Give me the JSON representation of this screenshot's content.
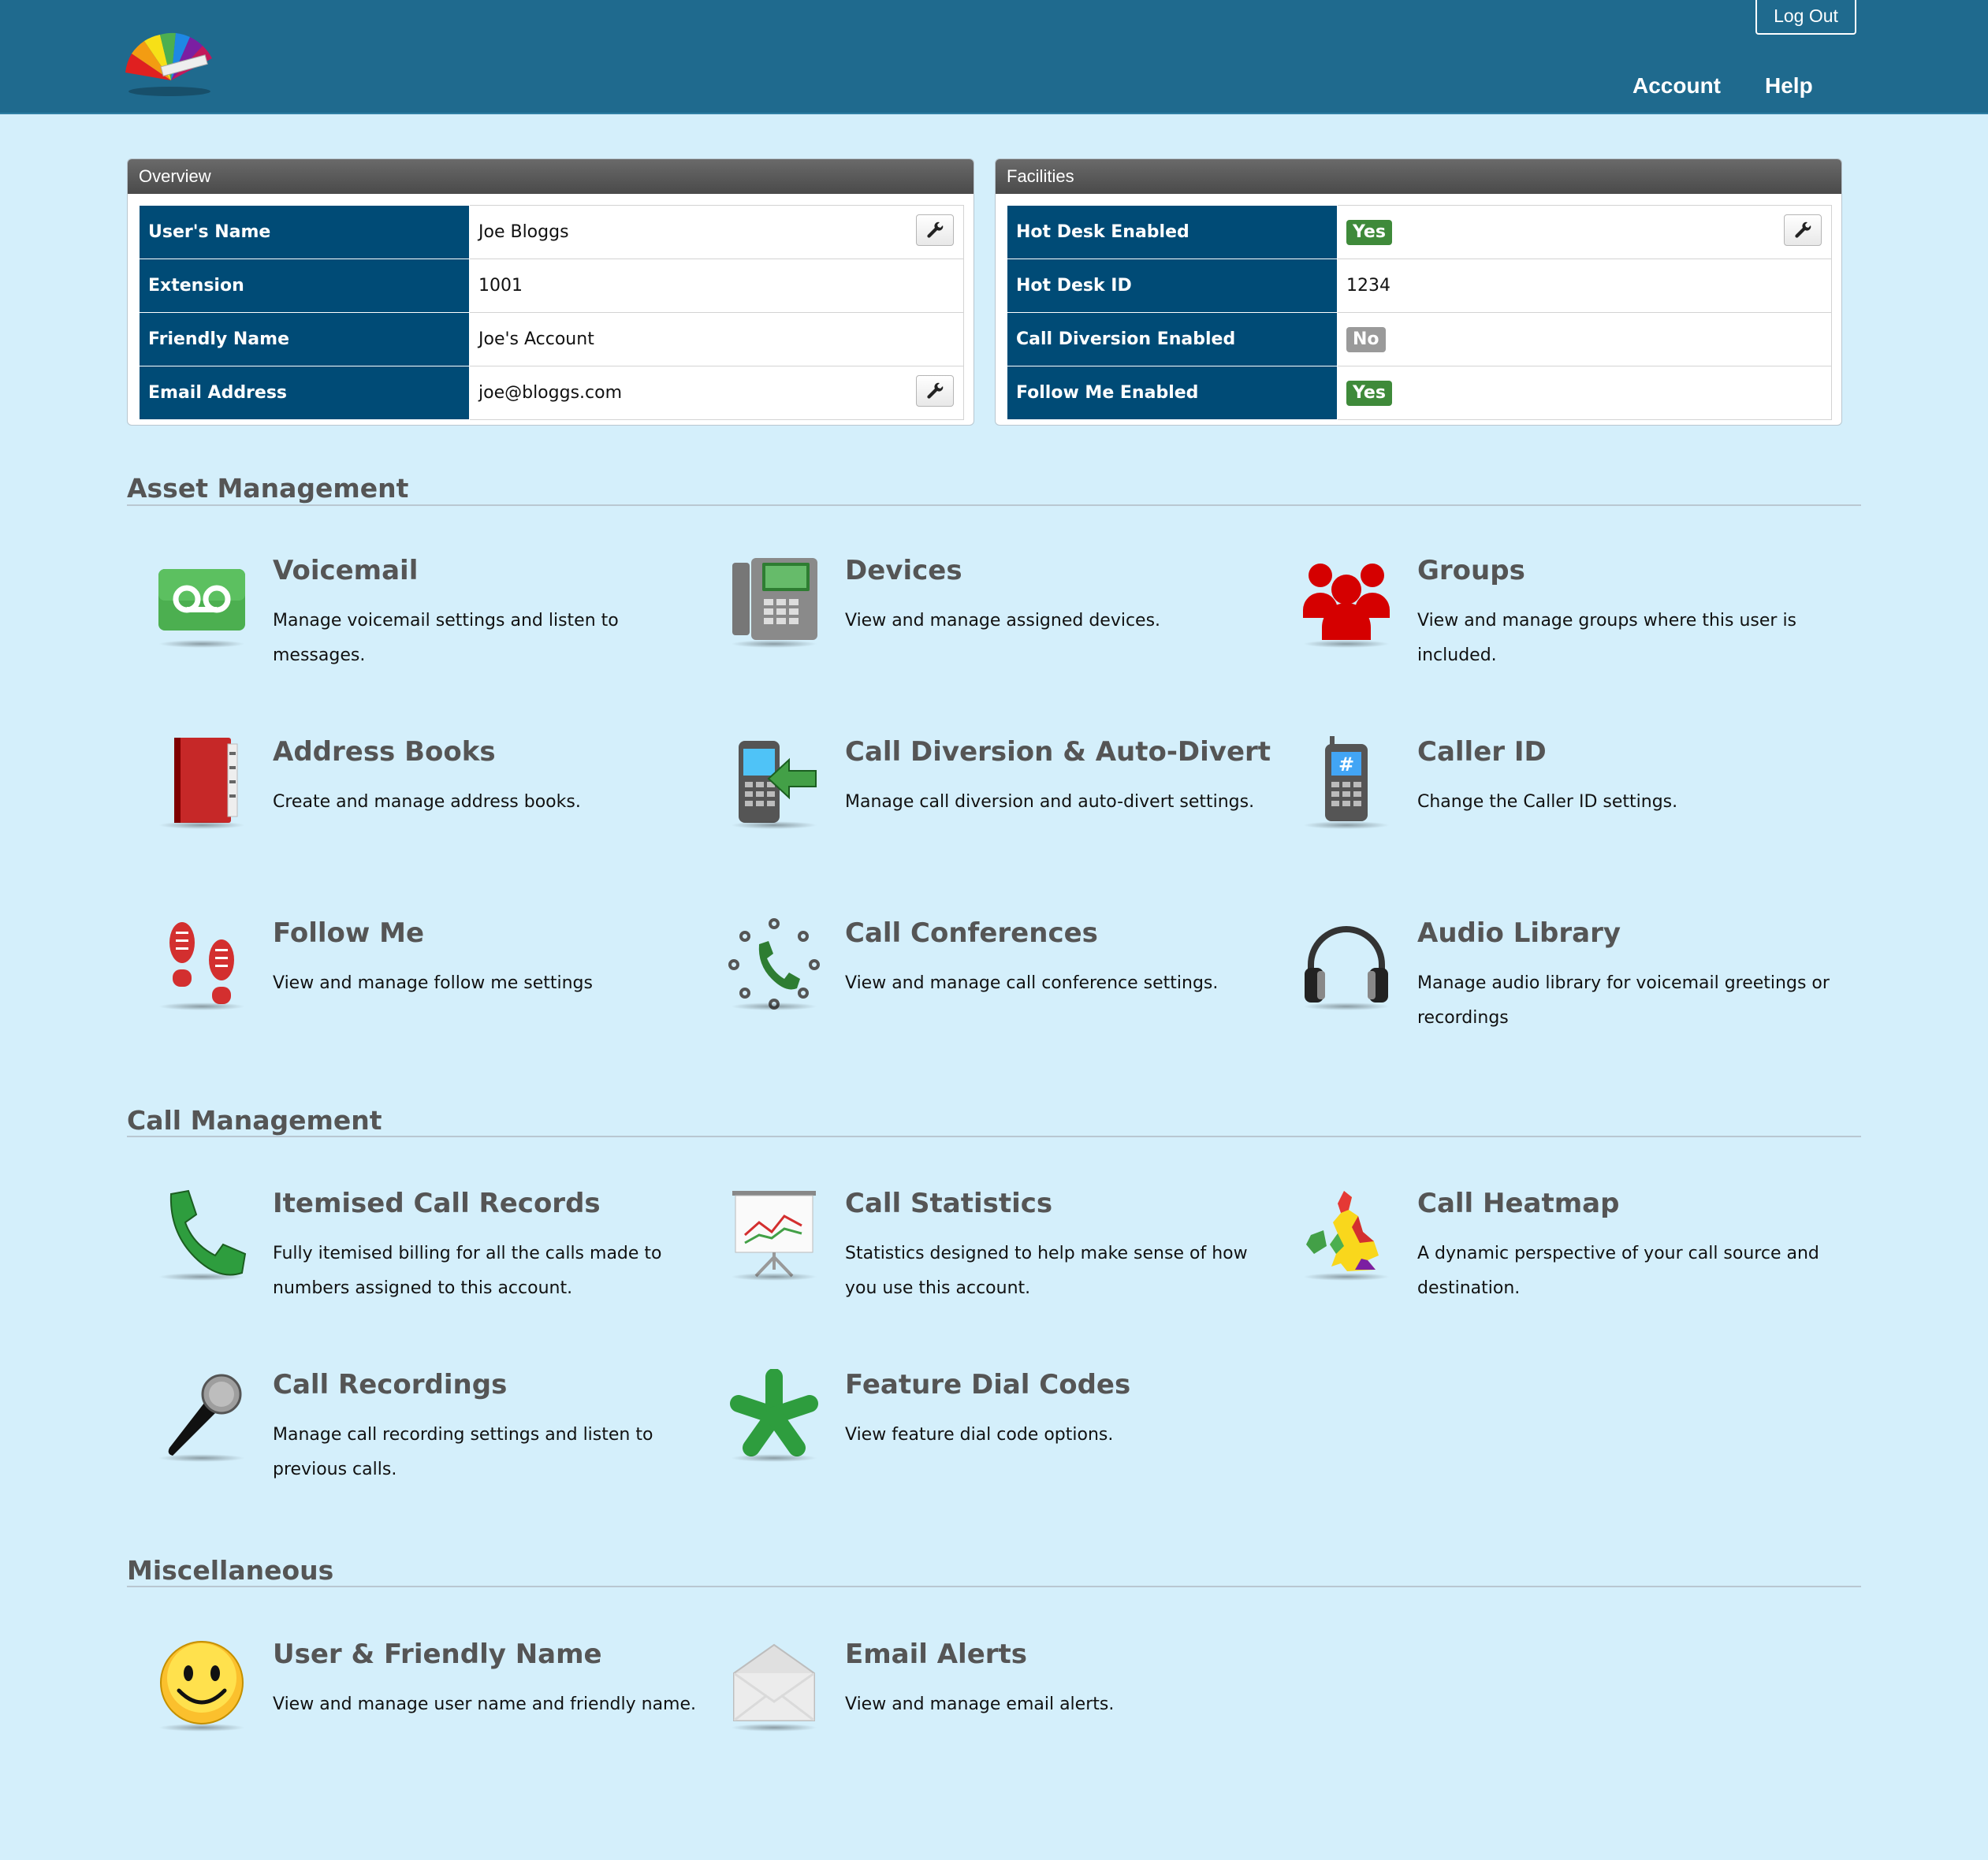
{
  "header": {
    "logout_label": "Log Out",
    "nav": {
      "account": "Account",
      "help": "Help"
    }
  },
  "overview": {
    "title": "Overview",
    "rows": [
      {
        "label": "User's Name",
        "value": "Joe Bloggs"
      },
      {
        "label": "Extension",
        "value": "1001"
      },
      {
        "label": "Friendly Name",
        "value": "Joe's Account"
      },
      {
        "label": "Email Address",
        "value": "joe@bloggs.com"
      }
    ]
  },
  "facilities": {
    "title": "Facilities",
    "rows": [
      {
        "label": "Hot Desk Enabled",
        "value": "Yes"
      },
      {
        "label": "Hot Desk ID",
        "value": "1234"
      },
      {
        "label": "Call Diversion Enabled",
        "value": "No"
      },
      {
        "label": "Follow Me Enabled",
        "value": "Yes"
      }
    ]
  },
  "sections": {
    "asset": {
      "title": "Asset Management",
      "items": [
        {
          "title": "Voicemail",
          "desc": "Manage voicemail settings and listen to messages.",
          "icon": "voicemail-icon"
        },
        {
          "title": "Devices",
          "desc": "View and manage assigned devices.",
          "icon": "desk-phone-icon"
        },
        {
          "title": "Groups",
          "desc": "View and manage groups where this user is included.",
          "icon": "group-icon"
        },
        {
          "title": "Address Books",
          "desc": "Create and manage address books.",
          "icon": "address-book-icon"
        },
        {
          "title": "Call Diversion & Auto-Divert",
          "desc": "Manage call diversion and auto-divert settings.",
          "icon": "call-diversion-icon"
        },
        {
          "title": "Caller ID",
          "desc": "Change the Caller ID settings.",
          "icon": "mobile-phone-icon"
        },
        {
          "title": "Follow Me",
          "desc": "View and manage follow me settings",
          "icon": "footprints-icon"
        },
        {
          "title": "Call Conferences",
          "desc": "View and manage call conference settings.",
          "icon": "conference-icon"
        },
        {
          "title": "Audio Library",
          "desc": "Manage audio library for voicemail greetings or recordings",
          "icon": "headphones-icon"
        }
      ]
    },
    "call": {
      "title": "Call Management",
      "items": [
        {
          "title": "Itemised Call Records",
          "desc": "Fully itemised billing for all the calls made to numbers assigned to this account.",
          "icon": "phone-handset-icon"
        },
        {
          "title": "Call Statistics",
          "desc": "Statistics designed to help make sense of how you use this account.",
          "icon": "statistics-board-icon"
        },
        {
          "title": "Call Heatmap",
          "desc": "A dynamic perspective of your call source and destination.",
          "icon": "heatmap-icon"
        },
        {
          "title": "Call Recordings",
          "desc": "Manage call recording settings and listen to previous calls.",
          "icon": "microphone-icon"
        },
        {
          "title": "Feature Dial Codes",
          "desc": "View feature dial code options.",
          "icon": "asterisk-icon"
        }
      ]
    },
    "misc": {
      "title": "Miscellaneous",
      "items": [
        {
          "title": "User & Friendly Name",
          "desc": "View and manage user name and friendly name.",
          "icon": "smiley-icon"
        },
        {
          "title": "Email Alerts",
          "desc": "View and manage email alerts.",
          "icon": "envelope-icon"
        }
      ]
    }
  },
  "colors": {
    "header_bg": "#1f6a8e",
    "page_bg": "#d4effb",
    "table_key_bg": "#004b76",
    "badge_yes": "#3f8a3a",
    "badge_no": "#9a9a9a"
  }
}
